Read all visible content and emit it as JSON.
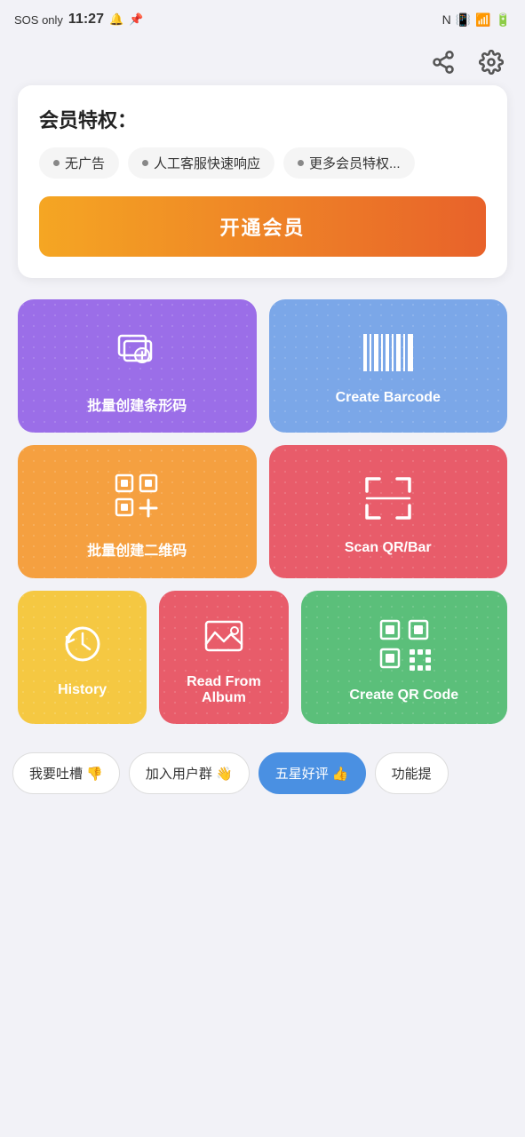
{
  "statusBar": {
    "left": "SOS only",
    "time": "11:27",
    "bellIcon": "🔔",
    "pinIcon": "📌"
  },
  "toolbar": {
    "shareIcon": "share",
    "settingsIcon": "settings"
  },
  "memberCard": {
    "title": "会员特权：",
    "tags": [
      {
        "label": "无广告"
      },
      {
        "label": "人工客服快速响应"
      },
      {
        "label": "更多会员特权..."
      }
    ],
    "buttonLabel": "开通会员"
  },
  "tiles": [
    {
      "id": "batch-barcode",
      "label": "批量创建条形码",
      "color": "purple",
      "icon": "batch-barcode-icon"
    },
    {
      "id": "create-barcode",
      "label": "Create Barcode",
      "color": "blue-light",
      "icon": "barcode-icon"
    },
    {
      "id": "batch-qr",
      "label": "批量创建二维码",
      "color": "orange",
      "icon": "batch-qr-icon"
    },
    {
      "id": "scan-qrbar",
      "label": "Scan QR/Bar",
      "color": "red",
      "icon": "scan-icon"
    },
    {
      "id": "history",
      "label": "History",
      "color": "yellow",
      "icon": "history-icon"
    },
    {
      "id": "read-album",
      "label": "Read From Album",
      "color": "red2",
      "icon": "album-icon"
    },
    {
      "id": "create-qr",
      "label": "Create QR Code",
      "color": "green",
      "icon": "qr-icon"
    }
  ],
  "bottomBar": {
    "buttons": [
      {
        "label": "我要吐槽 👎",
        "active": false
      },
      {
        "label": "加入用户群 👋",
        "active": false
      },
      {
        "label": "五星好评 👍",
        "active": true
      },
      {
        "label": "功能提",
        "active": false
      }
    ]
  }
}
